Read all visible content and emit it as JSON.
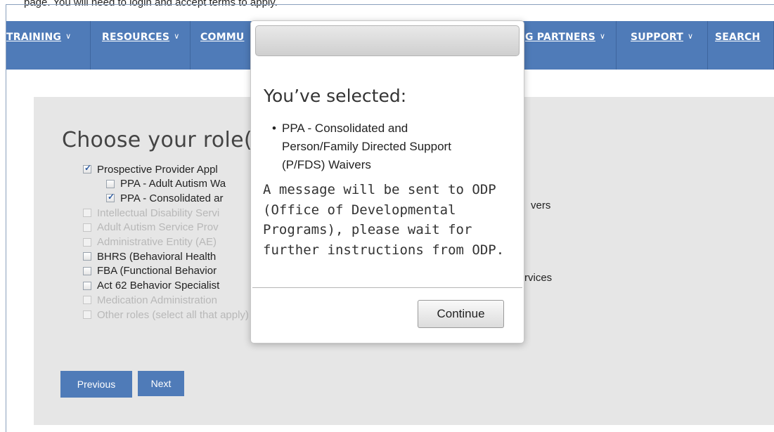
{
  "intro_fragment": "page.     You will need to login and accept terms to apply.",
  "nav": {
    "training": "TRAINING",
    "resources": "RESOURCES",
    "community": "COMMU",
    "partners": "G PARTNERS",
    "support": "SUPPORT",
    "search": "SEARCH"
  },
  "roles": {
    "heading": "Choose your role(s",
    "items": [
      {
        "label": "Prospective Provider Appl",
        "checked": true,
        "disabled": false,
        "indent": 0
      },
      {
        "label": "PPA - Adult Autism Wa",
        "checked": false,
        "disabled": false,
        "indent": 1
      },
      {
        "label": "PPA - Consolidated ar",
        "checked": true,
        "disabled": false,
        "indent": 1
      },
      {
        "label": "Intellectual Disability Servi",
        "checked": false,
        "disabled": true,
        "indent": 0
      },
      {
        "label": "Adult Autism Service Prov",
        "checked": false,
        "disabled": true,
        "indent": 0
      },
      {
        "label": "Administrative Entity (AE)",
        "checked": false,
        "disabled": true,
        "indent": 0
      },
      {
        "label": "BHRS (Behavioral Health",
        "checked": false,
        "disabled": false,
        "indent": 0
      },
      {
        "label": "FBA (Functional Behavior",
        "checked": false,
        "disabled": false,
        "indent": 0
      },
      {
        "label": "Act 62 Behavior Specialist",
        "checked": false,
        "disabled": false,
        "indent": 0
      },
      {
        "label": "Medication Administration",
        "checked": false,
        "disabled": true,
        "indent": 0
      },
      {
        "label": "Other roles (select all that apply)",
        "checked": false,
        "disabled": true,
        "indent": 0
      }
    ],
    "right_fragment_1": "vers",
    "right_fragment_2": "rvices"
  },
  "buttons": {
    "previous": "Previous",
    "next": "Next"
  },
  "modal": {
    "title": "You’ve selected:",
    "selected": [
      "PPA - Consolidated and",
      "Person/Family Directed Support",
      "(P/FDS) Waivers"
    ],
    "message": "A message will be sent to ODP (Office of Developmental Programs), please wait for further instructions from ODP.",
    "continue_label": "Continue"
  },
  "colors": {
    "nav_bg": "#4f7bb8",
    "panel_bg": "#e6e6e6",
    "button_bg": "#4f7bb8"
  }
}
